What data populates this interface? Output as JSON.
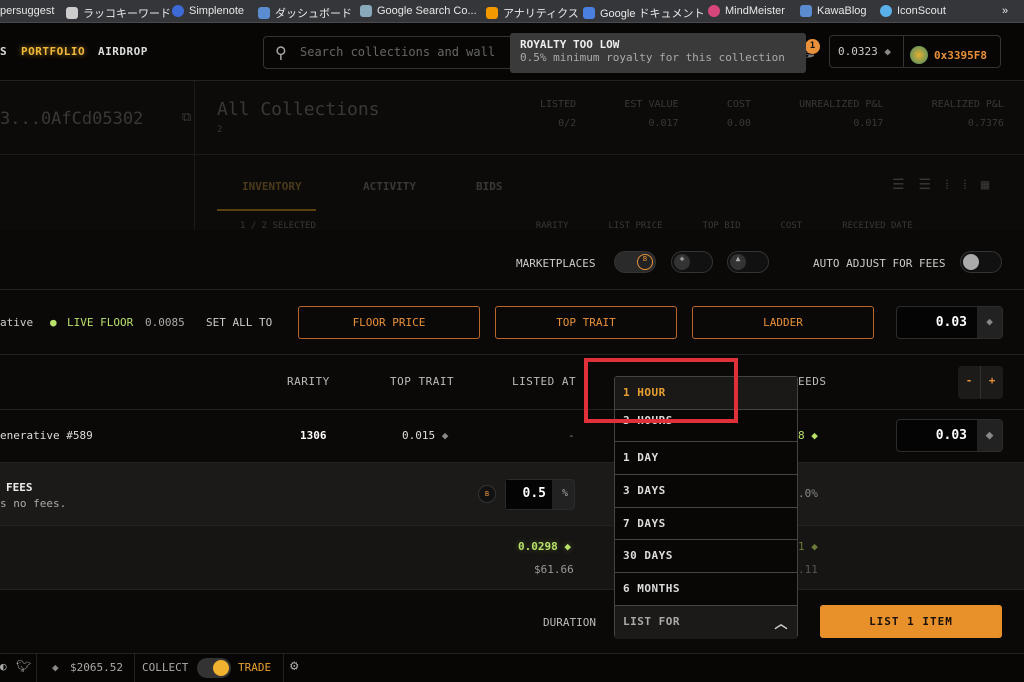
{
  "bookmarks": [
    "persuggest",
    "ラッコキーワード",
    "Simplenote",
    "ダッシュボード",
    "Google Search Co...",
    "アナリティクス",
    "Google ドキュメント",
    "MindMeister",
    "KawaBlog",
    "IconScout",
    "»"
  ],
  "nav": {
    "items": [
      "S",
      "PORTFOLIO",
      "AIRDROP"
    ],
    "search_placeholder": "Search collections and wall",
    "notif_count": "1",
    "balance": "0.0323",
    "wallet": "0x3395F8"
  },
  "tooltip": {
    "title": "ROYALTY TOO LOW",
    "text": "0.5% minimum royalty for this collection"
  },
  "background": {
    "address": "3...0AfCd05302",
    "collections_title": "All Collections",
    "collections_count": "2",
    "stats": [
      {
        "label": "LISTED",
        "value": "0/2"
      },
      {
        "label": "EST VALUE",
        "value": "0.017"
      },
      {
        "label": "COST",
        "value": "0.00"
      },
      {
        "label": "UNREALIZED P&L",
        "value": "0.017"
      },
      {
        "label": "REALIZED P&L",
        "value": "0.7376"
      }
    ],
    "tabs": [
      "INVENTORY",
      "ACTIVITY",
      "BIDS"
    ],
    "table_headers": [
      "1 / 2 SELECTED",
      "RARITY",
      "LIST PRICE",
      "TOP BID",
      "COST",
      "RECEIVED DATE"
    ]
  },
  "modal": {
    "marketplaces_label": "MARKETPLACES",
    "auto_adjust_label": "AUTO ADJUST FOR FEES",
    "collection_partial": "ative",
    "live_floor_label": "LIVE FLOOR",
    "live_floor_value": "0.0085",
    "set_all_to": "SET ALL TO",
    "buttons": [
      "FLOOR PRICE",
      "TOP TRAIT",
      "LADDER"
    ],
    "set_all_value": "0.03",
    "headers": [
      "RARITY",
      "TOP TRAIT",
      "LISTED AT",
      "EEDS"
    ],
    "item": {
      "name": "enerative #589",
      "rarity": "1306",
      "top_trait": "0.015",
      "listed_at": "-",
      "proceeds_partial": "8",
      "price": "0.03"
    },
    "fees": {
      "title": "FEES",
      "desc": "s no fees.",
      "royalty": "0.5",
      "unit": "%",
      "partial": ".0%"
    },
    "totals": {
      "eth": "0.0298",
      "usd": "$61.66",
      "partial_eth": "1",
      "partial_usd": ".11"
    },
    "duration_label": "DURATION",
    "list_button": "LIST 1 ITEM",
    "duration_options": [
      "1 HOUR",
      "3 HOURS",
      "1 DAY",
      "3 DAYS",
      "7 DAYS",
      "30 DAYS",
      "6 MONTHS"
    ],
    "duration_selected": "LIST FOR"
  },
  "footer": {
    "eth_price": "$2065.52",
    "collect": "COLLECT",
    "trade": "TRADE"
  },
  "colors": {
    "accent": "#e8913a",
    "live": "#b8e06a",
    "highlight": "#e0303a"
  }
}
